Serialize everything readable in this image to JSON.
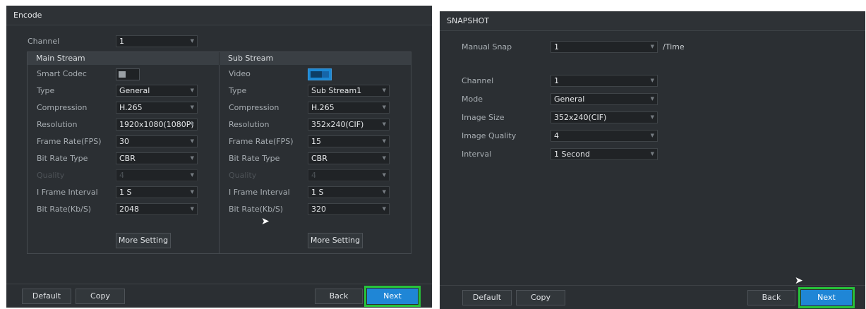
{
  "encode": {
    "title": "Encode",
    "channel": {
      "label": "Channel",
      "value": "1"
    },
    "main_stream": {
      "header": "Main Stream",
      "fields": [
        {
          "label": "Smart Codec",
          "kind": "toggle",
          "on": false
        },
        {
          "label": "Type",
          "value": "General"
        },
        {
          "label": "Compression",
          "value": "H.265"
        },
        {
          "label": "Resolution",
          "value": "1920x1080(1080P)"
        },
        {
          "label": "Frame Rate(FPS)",
          "value": "30"
        },
        {
          "label": "Bit Rate Type",
          "value": "CBR"
        },
        {
          "label": "Quality",
          "value": "4",
          "disabled": true
        },
        {
          "label": "I Frame Interval",
          "value": "1 S"
        },
        {
          "label": "Bit Rate(Kb/S)",
          "value": "2048"
        }
      ],
      "more_setting": "More Setting"
    },
    "sub_stream": {
      "header": "Sub Stream",
      "fields": [
        {
          "label": "Video",
          "kind": "toggle",
          "on": true
        },
        {
          "label": "Type",
          "value": "Sub Stream1"
        },
        {
          "label": "Compression",
          "value": "H.265"
        },
        {
          "label": "Resolution",
          "value": "352x240(CIF)"
        },
        {
          "label": "Frame Rate(FPS)",
          "value": "15"
        },
        {
          "label": "Bit Rate Type",
          "value": "CBR"
        },
        {
          "label": "Quality",
          "value": "4",
          "disabled": true
        },
        {
          "label": "I Frame Interval",
          "value": "1 S"
        },
        {
          "label": "Bit Rate(Kb/S)",
          "value": "320"
        }
      ],
      "more_setting": "More Setting"
    },
    "footer": {
      "default": "Default",
      "copy": "Copy",
      "back": "Back",
      "next": "Next"
    }
  },
  "snapshot": {
    "title": "SNAPSHOT",
    "manual_snap": {
      "label": "Manual Snap",
      "value": "1",
      "unit": "/Time"
    },
    "fields": [
      {
        "label": "Channel",
        "value": "1"
      },
      {
        "label": "Mode",
        "value": "General"
      },
      {
        "label": "Image Size",
        "value": "352x240(CIF)"
      },
      {
        "label": "Image Quality",
        "value": "4"
      },
      {
        "label": "Interval",
        "value": "1 Second"
      }
    ],
    "footer": {
      "default": "Default",
      "copy": "Copy",
      "back": "Back",
      "next": "Next"
    }
  },
  "colors": {
    "accent": "#1f86d6",
    "highlight": "#27c23a",
    "panel": "#2b2f33"
  }
}
